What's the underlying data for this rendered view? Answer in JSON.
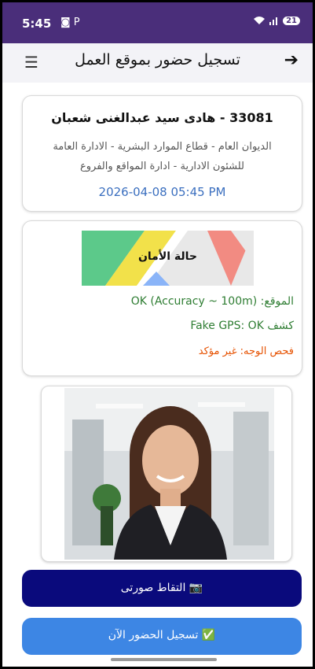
{
  "status": {
    "time": "5:45",
    "left_icons": "◙ P",
    "right_icons": "wifi ▂▄▆",
    "battery": "21"
  },
  "appbar": {
    "title": "تسجيل حضور بموقع العمل",
    "menu_icon": "hamburger-icon",
    "back_icon": "arrow-right-icon"
  },
  "employee": {
    "name": "33081 - هادى سيد عبدالغنى شعبان",
    "department_line1": "الديوان العام - قطاع الموارد البشرية - الادارة العامة",
    "department_line2": "للشئون الادارية  - ادارة المواقع والفروع",
    "datetime": "2026-04-08 05:45 PM"
  },
  "safety": {
    "map_label": "حالة الأمان",
    "location_label": "الموقع:",
    "location_value": "OK (Accuracy ~ 100m)",
    "gps_label": "كشف",
    "gps_value": "Fake GPS: OK",
    "face_check": "فحص الوجه: غير مؤكد"
  },
  "buttons": {
    "capture": "📷 التقاط صورتى",
    "register": "✅ تسجيل الحضور الآن"
  },
  "colors": {
    "status_bar": "#4a2e7a",
    "primary": "#0a0a7c",
    "secondary": "#3d86e4",
    "ok": "#2e7d32",
    "warn": "#e65100",
    "date": "#3b6fbf"
  }
}
